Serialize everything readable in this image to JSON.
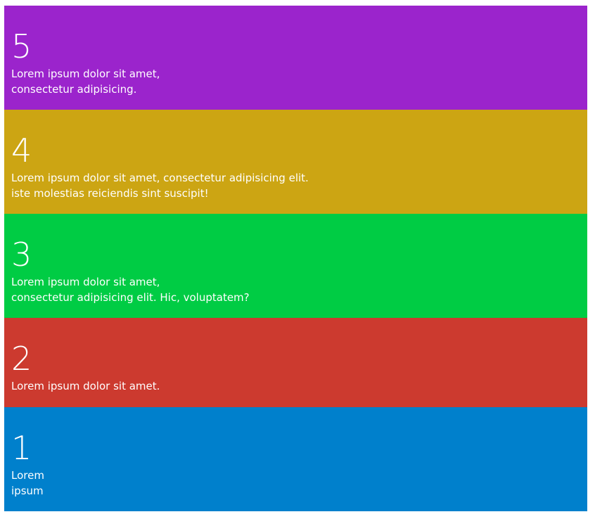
{
  "panels": [
    {
      "number": "5",
      "line1": "Lorem ipsum dolor sit amet,",
      "line2": "consectetur adipisicing.",
      "color": "#9b24cc"
    },
    {
      "number": "4",
      "line1": "Lorem ipsum dolor sit amet, consectetur adipisicing elit.",
      "line2": "iste molestias reiciendis sint suscipit!",
      "color": "#cca513"
    },
    {
      "number": "3",
      "line1": "Lorem ipsum dolor sit amet,",
      "line2": "consectetur adipisicing elit. Hic, voluptatem?",
      "color": "#00cc44"
    },
    {
      "number": "2",
      "line1": "Lorem ipsum dolor sit amet.",
      "line2": "",
      "color": "#cc3a2f"
    },
    {
      "number": "1",
      "line1": "Lorem",
      "line2": "ipsum",
      "color": "#0080cc"
    }
  ]
}
